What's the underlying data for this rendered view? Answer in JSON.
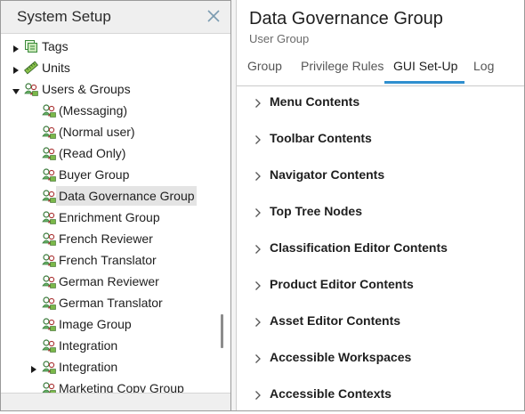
{
  "left_panel": {
    "title": "System Setup",
    "tree": [
      {
        "label": "Tags",
        "icon": "tags-icon",
        "expander": "collapsed"
      },
      {
        "label": "Units",
        "icon": "units-icon",
        "expander": "collapsed"
      },
      {
        "label": "Users & Groups",
        "icon": "users-group-icon",
        "expander": "expanded"
      },
      {
        "label": "(Messaging)",
        "icon": "user-group-icon",
        "expander": "none"
      },
      {
        "label": "(Normal user)",
        "icon": "user-group-icon",
        "expander": "none"
      },
      {
        "label": "(Read Only)",
        "icon": "user-group-icon",
        "expander": "none"
      },
      {
        "label": "Buyer Group",
        "icon": "user-group-icon",
        "expander": "none"
      },
      {
        "label": "Data Governance Group",
        "icon": "user-group-icon",
        "expander": "none",
        "selected": true
      },
      {
        "label": "Enrichment Group",
        "icon": "user-group-icon",
        "expander": "none"
      },
      {
        "label": "French Reviewer",
        "icon": "user-group-icon",
        "expander": "none"
      },
      {
        "label": "French Translator",
        "icon": "user-group-icon",
        "expander": "none"
      },
      {
        "label": "German Reviewer",
        "icon": "user-group-icon",
        "expander": "none"
      },
      {
        "label": "German Translator",
        "icon": "user-group-icon",
        "expander": "none"
      },
      {
        "label": "Image Group",
        "icon": "user-group-icon",
        "expander": "none"
      },
      {
        "label": "Integration",
        "icon": "user-group-icon",
        "expander": "none"
      },
      {
        "label": "Integration",
        "icon": "user-group-icon",
        "expander": "collapsed"
      },
      {
        "label": "Marketing Copy Group",
        "icon": "user-group-icon",
        "expander": "none"
      }
    ]
  },
  "right_panel": {
    "title": "Data Governance Group",
    "subtitle": "User Group",
    "tabs": [
      {
        "label": "Group",
        "active": false
      },
      {
        "label": "Privilege Rules",
        "active": false
      },
      {
        "label": "GUI Set-Up",
        "active": true
      },
      {
        "label": "Log",
        "active": false
      }
    ],
    "sections": [
      "Menu Contents",
      "Toolbar Contents",
      "Navigator Contents",
      "Top Tree Nodes",
      "Classification Editor Contents",
      "Product Editor Contents",
      "Asset Editor Contents",
      "Accessible Workspaces",
      "Accessible Contexts"
    ]
  },
  "colors": {
    "accent": "#2f8fcf",
    "header_bg": "#efefef",
    "selected_bg": "#e4e4e4",
    "icon_green": "#3a9a3a",
    "icon_red": "#c0392b"
  }
}
